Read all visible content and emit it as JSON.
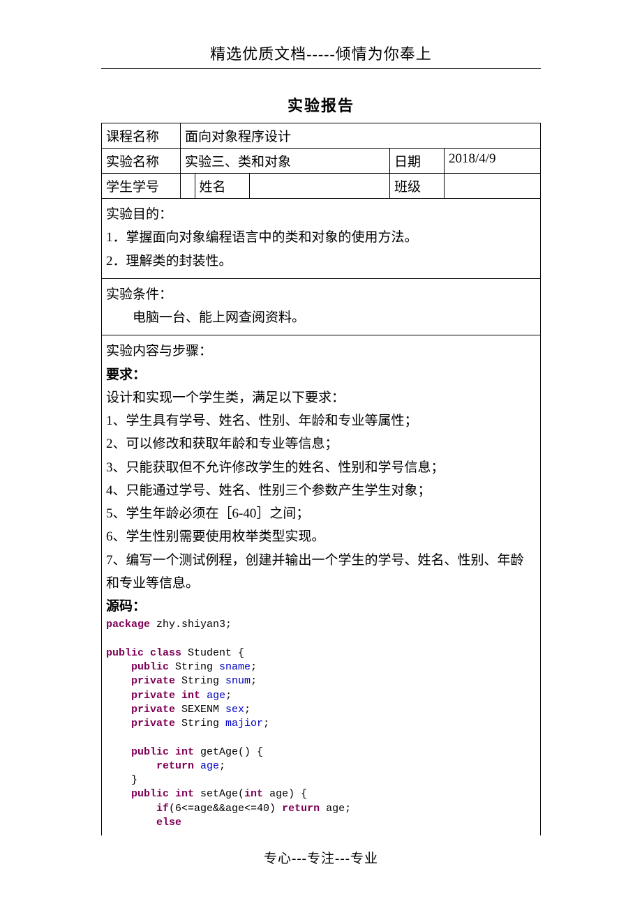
{
  "header": "精选优质文档-----倾情为你奉上",
  "title": "实验报告",
  "labels": {
    "course": "课程名称",
    "exp": "实验名称",
    "date": "日期",
    "sid": "学生学号",
    "name": "姓名",
    "class": "班级"
  },
  "values": {
    "course": "面向对象程序设计",
    "exp": "实验三、类和对象",
    "date": "2018/4/9",
    "sid": "",
    "name": "",
    "class": ""
  },
  "body": {
    "purpose_h": "实验目的：",
    "purpose_1": "1．掌握面向对象编程语言中的类和对象的使用方法。",
    "purpose_2": "2．理解类的封装性。",
    "cond_h": "实验条件：",
    "cond_1": "电脑一台、能上网查阅资料。",
    "steps_h": "实验内容与步骤：",
    "req_h": "要求：",
    "req_0": "设计和实现一个学生类，满足以下要求：",
    "req_1": "1、学生具有学号、姓名、性别、年龄和专业等属性；",
    "req_2": "2、可以修改和获取年龄和专业等信息；",
    "req_3": "3、只能获取但不允许修改学生的姓名、性别和学号信息；",
    "req_4": "4、只能通过学号、姓名、性别三个参数产生学生对象；",
    "req_5": "5、学生年龄必须在［6-40］之间；",
    "req_6": "6、学生性别需要使用枚举类型实现。",
    "req_7": "7、编写一个测试例程，创建并输出一个学生的学号、姓名、性别、年龄和专业等信息。",
    "src_h": "源码：",
    "code": {
      "pkg": "package",
      "pkg_v": " zhy.shiyan3;",
      "cls": "public class",
      "cls_v": " Student {",
      "f1a": "public",
      "f1b": " String ",
      "f1c": "sname",
      "f1d": ";",
      "f2a": "private",
      "f2b": " String ",
      "f2c": "snum",
      "f2d": ";",
      "f3a": "private int",
      "f3c": "age",
      "f3d": ";",
      "f4a": "private",
      "f4b": " SEXENM ",
      "f4c": "sex",
      "f4d": ";",
      "f5a": "private",
      "f5b": " String ",
      "f5c": "majior",
      "f5d": ";",
      "m1a": "public int",
      "m1b": " getAge() {",
      "m1c": "return",
      "m1d": "age",
      "m1e": ";",
      "m1f": "}",
      "m2a": "public int",
      "m2b": " setAge(",
      "m2c": "int",
      "m2d": " age) {",
      "m2e": "if",
      "m2f": "(6<=age&&age<=40) ",
      "m2g": "return",
      "m2h": " age;",
      "m2i": "else"
    }
  },
  "footer": "专心---专注---专业"
}
